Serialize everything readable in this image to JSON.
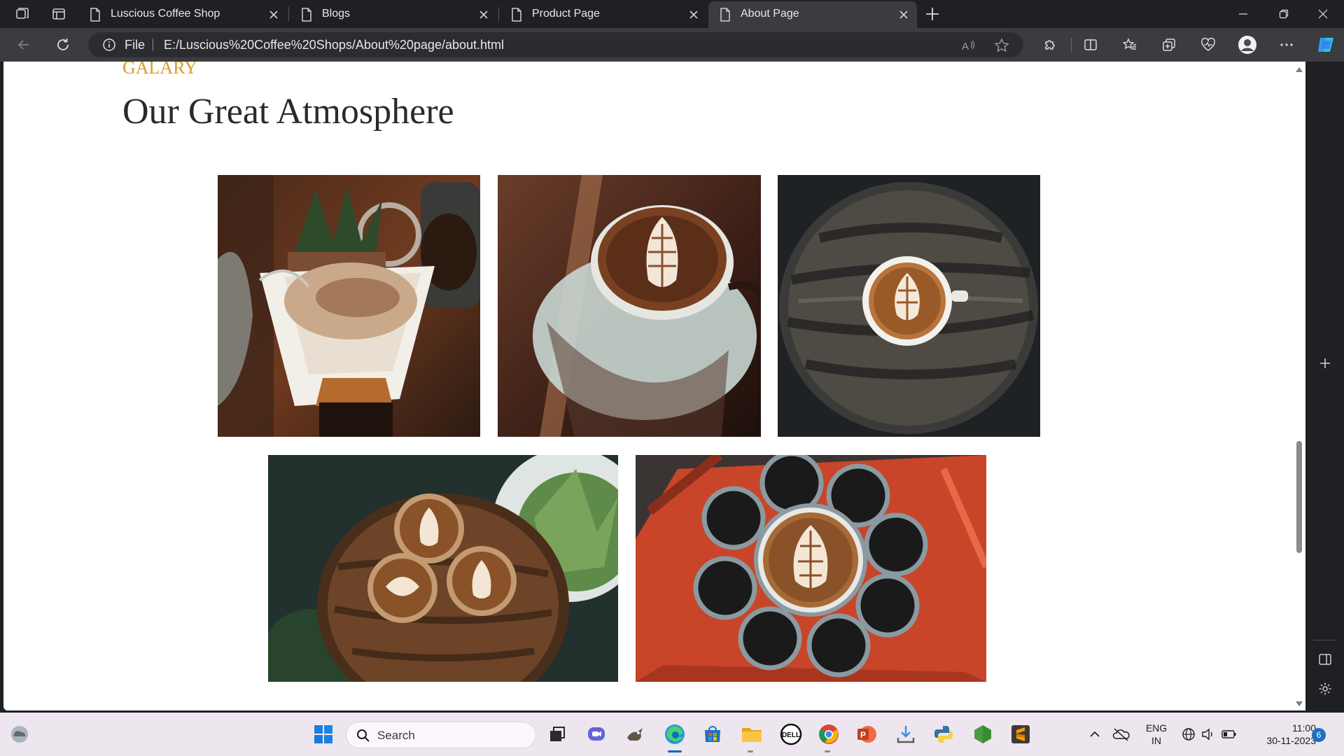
{
  "browser": {
    "tabs": [
      {
        "title": "Luscious Coffee Shop",
        "active": false
      },
      {
        "title": "Blogs",
        "active": false
      },
      {
        "title": "Product Page",
        "active": false
      },
      {
        "title": "About Page",
        "active": true
      }
    ],
    "address": {
      "scheme_label": "File",
      "url": "E:/Luscious%20Coffee%20Shops/About%20page/about.html"
    }
  },
  "page": {
    "section_label": "GALARY",
    "section_title": "Our Great Atmosphere",
    "gallery": [
      {
        "subject": "pour-over coffee with jar of beans"
      },
      {
        "subject": "latte art cup on saucer"
      },
      {
        "subject": "latte on round wooden stool"
      },
      {
        "subject": "three lattes on wooden stool"
      },
      {
        "subject": "cups of coffee on red stool"
      }
    ]
  },
  "taskbar": {
    "search_placeholder": "Search",
    "lang_line1": "ENG",
    "lang_line2": "IN",
    "time": "11:00",
    "date": "30-11-2023",
    "notification_count": "6"
  },
  "colors": {
    "accent": "#d99a2b",
    "browser_frame": "#1f2023",
    "toolbar": "#3b3c40",
    "taskbar": "#ede6ee"
  }
}
